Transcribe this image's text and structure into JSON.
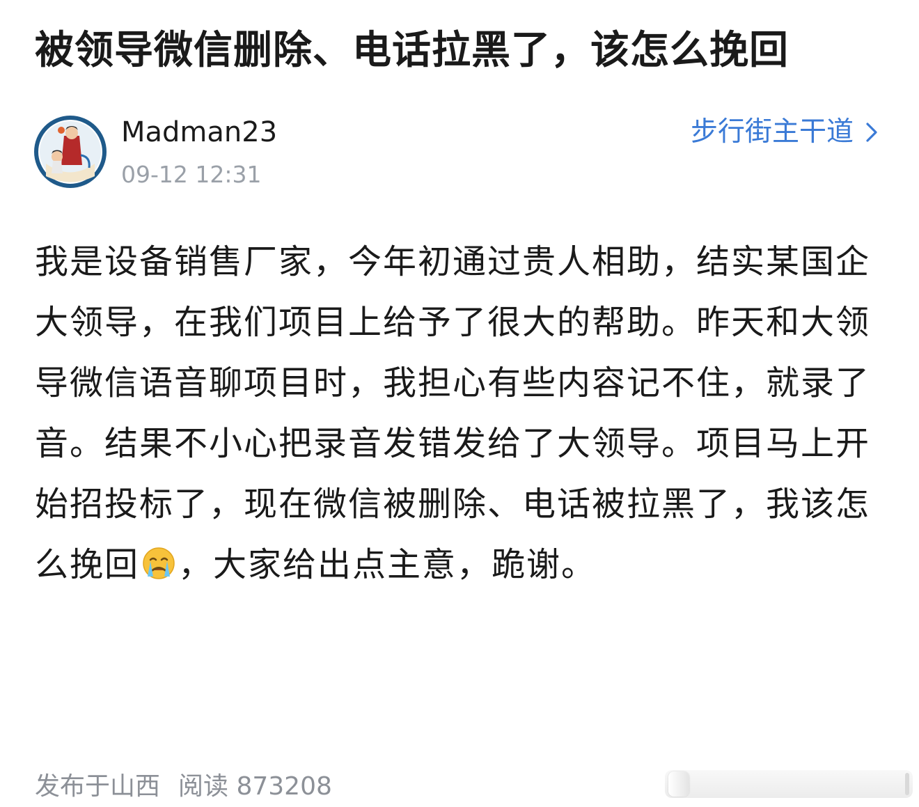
{
  "post": {
    "title": "被领导微信删除、电话拉黑了，该怎么挽回",
    "body_before_emoji": "我是设备销售厂家，今年初通过贵人相助，结实某国企大领导，在我们项目上给予了很大的帮助。昨天和大领导微信语音聊项目时，我担心有些内容记不住，就录了音。结果不小心把录音发错发给了大领导。项目马上开始招投标了，现在微信被删除、电话被拉黑了，我该怎么挽回",
    "emoji_icon": "crying-face-emoji",
    "body_after_emoji": "，大家给出点主意，跪谢。"
  },
  "author": {
    "name": "Madman23",
    "time": "09-12 12:31",
    "avatar_icon": "user-avatar"
  },
  "board": {
    "label": "步行街主干道",
    "icon": "chevron-right-icon"
  },
  "footer": {
    "location": "发布于山西",
    "reads": "阅读 873208"
  },
  "colors": {
    "link_blue": "#3a7ad6",
    "meta_gray": "#9aa0a8",
    "text": "#1a1a1a",
    "avatar_ring": "#1f5a8a"
  }
}
